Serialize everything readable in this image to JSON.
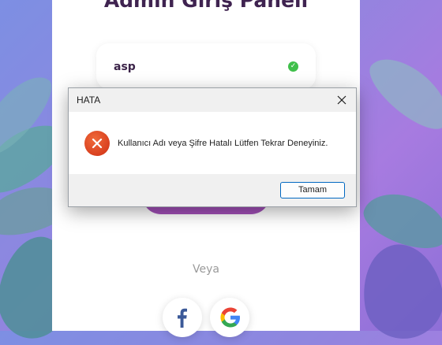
{
  "page": {
    "title": "Admin Giriş Paneli",
    "username_value": "asp",
    "or_text": "Veya"
  },
  "social": [
    {
      "icon": "facebook-icon"
    },
    {
      "icon": "google-icon"
    }
  ],
  "dialog": {
    "title": "HATA",
    "message": "Kullanıcı Adı veya Şifre Hatalı Lütfen Tekrar Deneyiniz.",
    "ok_label": "Tamam",
    "icon": "error-icon"
  },
  "colors": {
    "brand_purple": "#a24fb8",
    "title_color": "#3f2350",
    "check_green": "#3fbf4a",
    "error_red": "#d9401f",
    "accent_blue": "#0067c0"
  }
}
